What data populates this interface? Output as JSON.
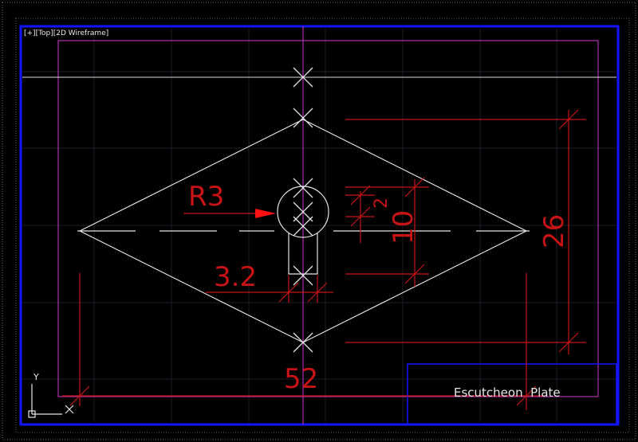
{
  "viewport": {
    "label": "[+][Top][2D Wireframe]"
  },
  "dimensions": {
    "radius": "R3",
    "slot_width": "3.2",
    "small_height": "2",
    "slot_height": "10",
    "plate_height": "26",
    "plate_width": "52"
  },
  "title_block": {
    "title": "Escutcheon  Plate"
  },
  "ucs": {
    "x_axis": "X",
    "y_axis": "Y"
  },
  "colors": {
    "background": "#000000",
    "viewport_border": "#1010ff",
    "margin_frame": "#b030b0",
    "geometry": "#e6e6e6",
    "dimension": "#c81414",
    "grid": "#1e1e2a"
  },
  "icons": [
    "ucs-icon",
    "dimension-arrow-icon"
  ]
}
